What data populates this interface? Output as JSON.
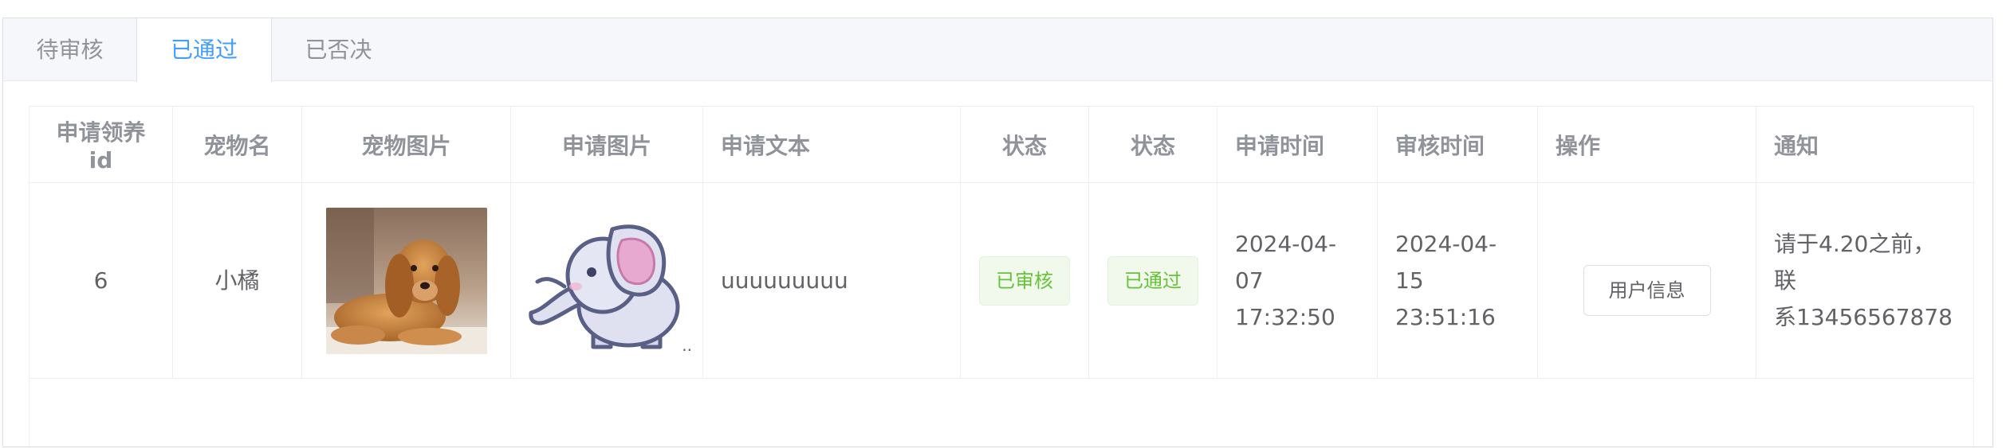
{
  "tabs": [
    {
      "label": "待审核"
    },
    {
      "label": "已通过"
    },
    {
      "label": "已否决"
    }
  ],
  "active_tab": "已通过",
  "table": {
    "headers": [
      "申请领养id",
      "宠物名",
      "宠物图片",
      "申请图片",
      "申请文本",
      "状态",
      "状态",
      "申请时间",
      "审核时间",
      "操作",
      "通知"
    ],
    "rows": [
      {
        "id": "6",
        "pet_name": "小橘",
        "pet_image_icon": "dog-photo",
        "apply_image_icon": "elephant-image",
        "apply_image_overflow": "..",
        "apply_text": "uuuuuuuuu",
        "status1": "已审核",
        "status2": "已通过",
        "apply_time_date": "2024-04-07",
        "apply_time_clock": "17:32:50",
        "review_time_date": "2024-04-15",
        "review_time_clock": "23:51:16",
        "action_label": "用户信息",
        "notice_line1": "请于4.20之前，联",
        "notice_line2": "系13456567878"
      }
    ]
  },
  "colors": {
    "accent": "#409eff",
    "success_text": "#67c23a",
    "success_bg": "#f0f9eb",
    "header_text": "#909399",
    "body_text": "#606266"
  }
}
